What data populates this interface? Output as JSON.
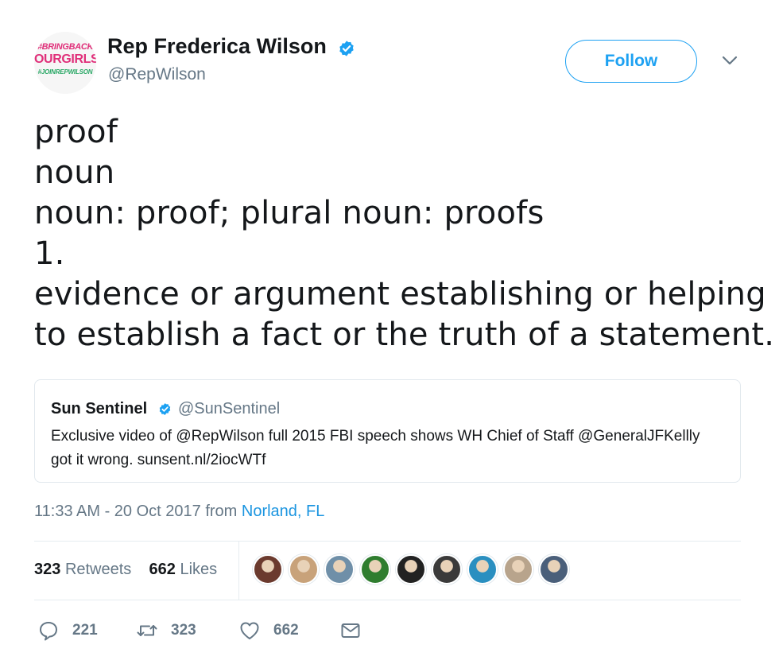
{
  "account": {
    "name": "Rep Frederica Wilson",
    "handle": "@RepWilson",
    "avatar_lines": [
      "#BRINGBACK",
      "OURGIRLS",
      "#JOINREPWILSON"
    ],
    "verified_color": "#1da1f2"
  },
  "follow_label": "Follow",
  "tweet": {
    "lines": [
      "proof",
      "noun",
      "noun: proof; plural noun: proofs",
      "1.",
      "evidence or argument establishing or helping",
      "to establish a fact or the truth of a statement."
    ]
  },
  "quoted": {
    "name": "Sun Sentinel",
    "handle": "@SunSentinel",
    "text": "Exclusive video of @RepWilson full 2015 FBI speech shows WH Chief of Staff @GeneralJFKellly got it wrong. sunsent.nl/2iocWTf"
  },
  "meta": {
    "time": "11:33 AM - 20 Oct 2017",
    "from": "from",
    "location": "Norland, FL"
  },
  "stats": {
    "retweets_count": "323",
    "retweets_label": "Retweets",
    "likes_count": "662",
    "likes_label": "Likes"
  },
  "likers": [
    {
      "icon": "liker-avatar",
      "color": "#6b3a2e"
    },
    {
      "icon": "liker-avatar",
      "color": "#c8a27a"
    },
    {
      "icon": "liker-avatar",
      "color": "#6f8fa8"
    },
    {
      "icon": "liker-avatar",
      "color": "#2f7d2f"
    },
    {
      "icon": "liker-avatar",
      "color": "#222222"
    },
    {
      "icon": "liker-avatar",
      "color": "#3a3a3a"
    },
    {
      "icon": "liker-avatar",
      "color": "#2a8fc0"
    },
    {
      "icon": "liker-avatar",
      "color": "#b8a48c"
    },
    {
      "icon": "liker-avatar",
      "color": "#4a5f7a"
    }
  ],
  "actions": {
    "reply_count": "221",
    "retweet_count": "323",
    "like_count": "662"
  },
  "colors": {
    "accent": "#1da1f2",
    "link": "#1b95e0",
    "muted": "#657786"
  }
}
